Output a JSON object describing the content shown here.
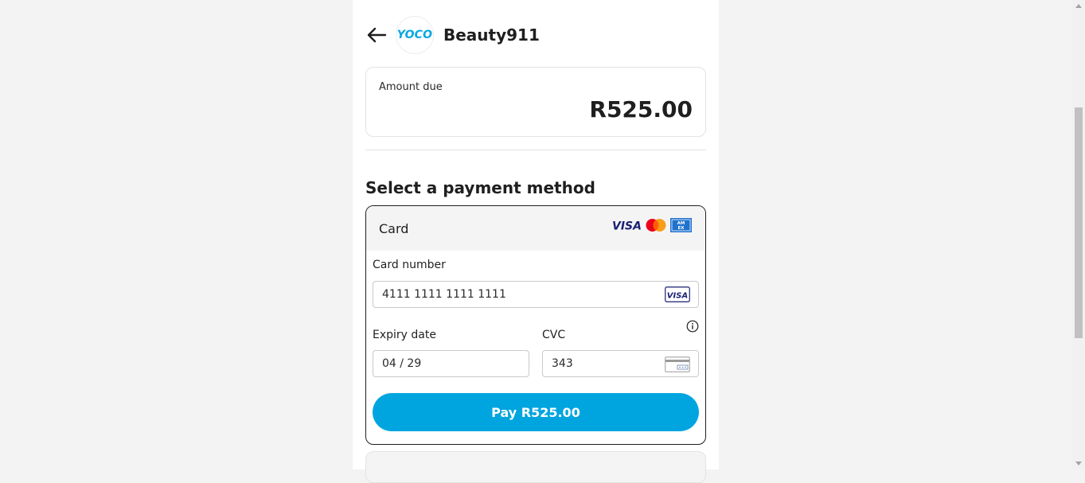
{
  "header": {
    "back_icon": "arrow-left-icon",
    "logo_text": "YOCO",
    "merchant_name": "Beauty911"
  },
  "amount": {
    "label": "Amount due",
    "value": "R525.00"
  },
  "payment": {
    "section_title": "Select a payment method",
    "card_method": {
      "label": "Card",
      "brands": [
        "VISA",
        "Mastercard",
        "American Express"
      ],
      "card_number_label": "Card number",
      "card_number_value": "4111 1111 1111 1111",
      "card_number_brand_icon": "visa-icon",
      "expiry_label": "Expiry date",
      "expiry_value": "04 / 29",
      "cvc_label": "CVC",
      "cvc_value": "343",
      "cvc_icon": "card-cvc-icon",
      "info_icon": "info-icon",
      "pay_button_label": "Pay R525.00"
    }
  },
  "colors": {
    "accent": "#00a5e0",
    "page_background": "#f3f3f3",
    "text": "#1f1f1f"
  }
}
